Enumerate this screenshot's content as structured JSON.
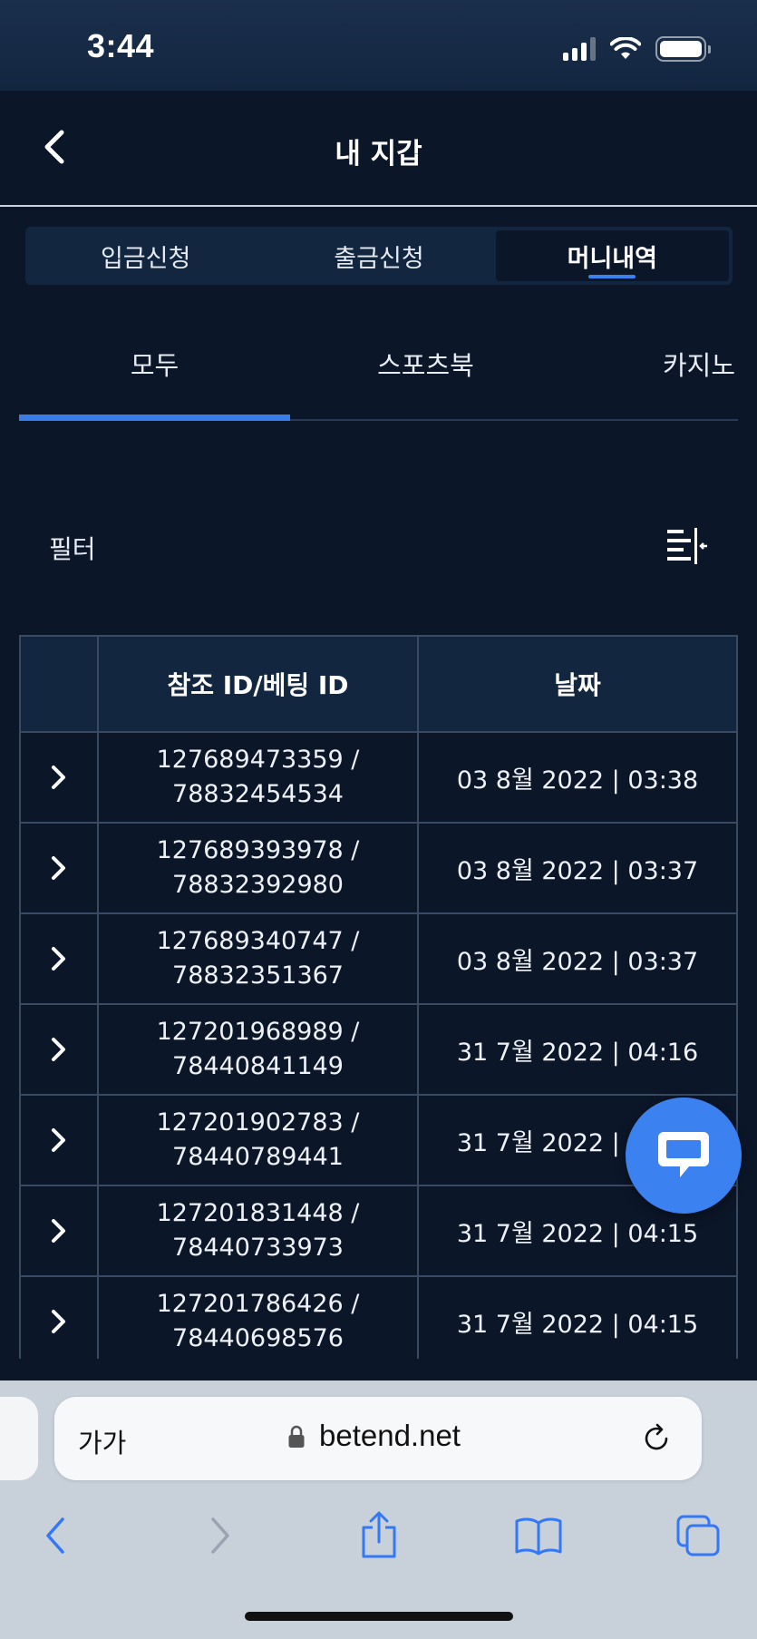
{
  "status_bar": {
    "time": "3:44"
  },
  "header": {
    "title": "내 지갑"
  },
  "segment_tabs": [
    {
      "label": "입금신청",
      "active": false
    },
    {
      "label": "출금신청",
      "active": false
    },
    {
      "label": "머니내역",
      "active": true
    }
  ],
  "category_tabs": [
    {
      "label": "모두",
      "active": true
    },
    {
      "label": "스포츠북",
      "active": false
    },
    {
      "label": "카지노",
      "active": false
    }
  ],
  "filter": {
    "label": "필터"
  },
  "table": {
    "headers": [
      "",
      "참조 ID/베팅 ID",
      "날짜"
    ],
    "rows": [
      {
        "ref_id": "127689473359 /",
        "bet_id": "78832454534",
        "date": "03 8월 2022 | 03:38"
      },
      {
        "ref_id": "127689393978 /",
        "bet_id": "78832392980",
        "date": "03 8월 2022 | 03:37"
      },
      {
        "ref_id": "127689340747 /",
        "bet_id": "78832351367",
        "date": "03 8월 2022 | 03:37"
      },
      {
        "ref_id": "127201968989 /",
        "bet_id": "78440841149",
        "date": "31 7월 2022 | 04:16"
      },
      {
        "ref_id": "127201902783 /",
        "bet_id": "78440789441",
        "date": "31 7월 2022 | 04:16"
      },
      {
        "ref_id": "127201831448 /",
        "bet_id": "78440733973",
        "date": "31 7월 2022 | 04:15"
      },
      {
        "ref_id": "127201786426 /",
        "bet_id": "78440698576",
        "date": "31 7월 2022 | 04:15"
      }
    ]
  },
  "browser": {
    "aa_label": "가가",
    "url": "betend.net"
  },
  "colors": {
    "background": "#0b1628",
    "accent": "#3b82f0",
    "header_bg": "#132640"
  }
}
